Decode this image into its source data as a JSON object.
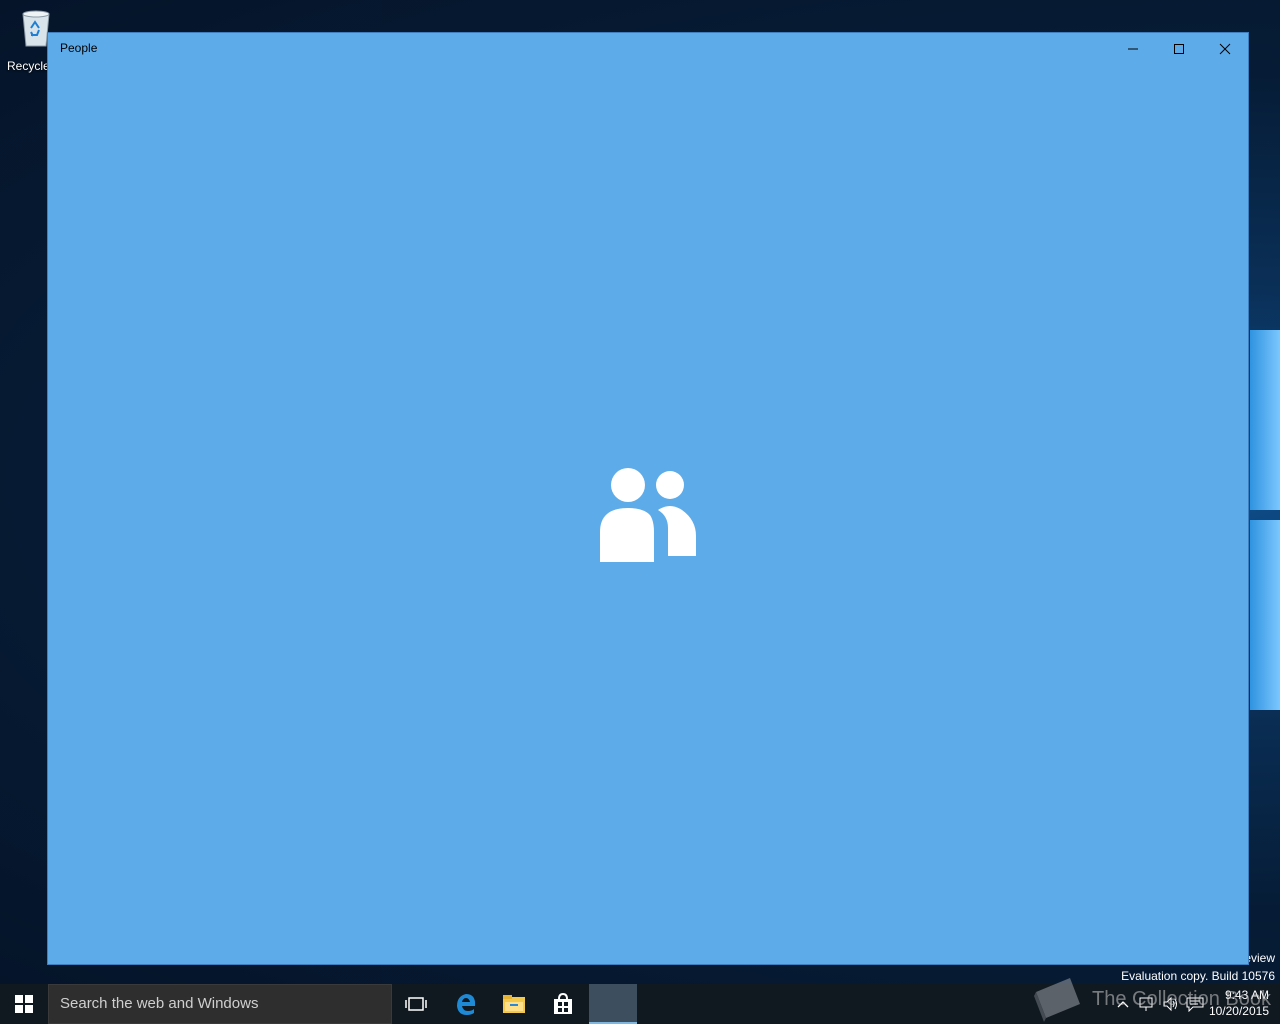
{
  "desktop": {
    "recycle_bin_label": "Recycle"
  },
  "window": {
    "title": "People",
    "background": "#5eabea"
  },
  "watermark": {
    "edition_fragment": "eview",
    "build_text": "Evaluation copy. Build 10576",
    "site_text": "The Collection Book"
  },
  "taskbar": {
    "search_placeholder": "Search the web and Windows",
    "pinned": [
      "task-view-icon",
      "edge-icon",
      "file-explorer-icon",
      "store-icon",
      "people-app-icon"
    ]
  },
  "tray": {
    "time": "9:43 AM",
    "date": "10/20/2015"
  }
}
